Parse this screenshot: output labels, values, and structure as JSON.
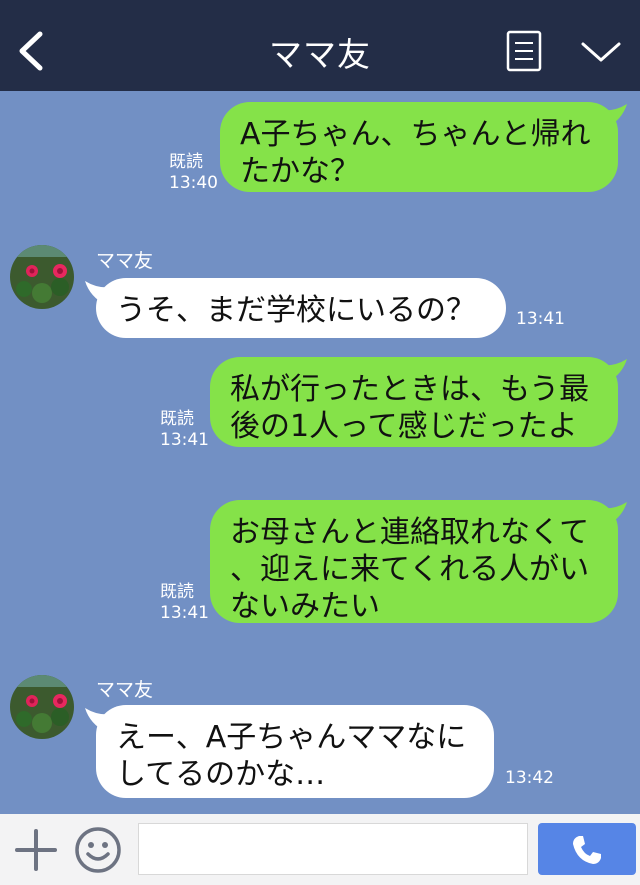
{
  "header": {
    "title": "ママ友",
    "icons": {
      "back": "back-chevron-icon",
      "menu": "menu-list-icon",
      "collapse": "chevron-down-icon"
    },
    "color": "#232d47"
  },
  "chat_background": "#7290c4",
  "messages": [
    {
      "direction": "sent",
      "text": "A子ちゃん、ちゃんと帰れ\nたかな？",
      "read": "既読",
      "time": "13:40"
    },
    {
      "direction": "received",
      "sender": "ママ友",
      "text": "うそ、まだ学校にいるの？",
      "time": "13:41"
    },
    {
      "direction": "sent",
      "text": "私が行ったときは、もう最\n後の1人って感じだったよ",
      "read": "既読",
      "time": "13:41"
    },
    {
      "direction": "sent",
      "text": "お母さんと連絡取れなくて\n、迎えに来てくれる人がい\nないみたい",
      "read": "既読",
      "time": "13:41"
    },
    {
      "direction": "received",
      "sender": "ママ友",
      "text": "えー、A子ちゃんママなに\nしてるのかな…",
      "time": "13:42"
    }
  ],
  "colors": {
    "sent_bubble": "#85e249",
    "received_bubble": "#ffffff",
    "call_button": "#5685e6"
  },
  "input_bar": {
    "text_value": "",
    "icons": {
      "add": "plus-icon",
      "sticker": "smile-icon",
      "call": "phone-icon"
    }
  }
}
